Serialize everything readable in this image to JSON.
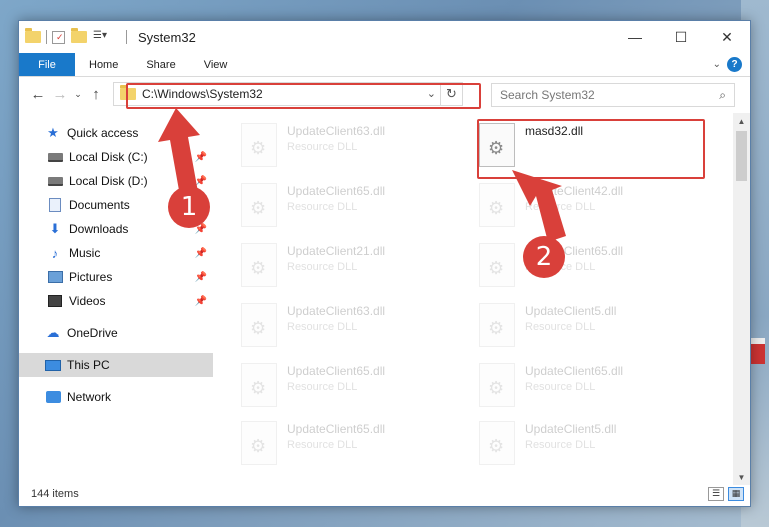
{
  "window": {
    "title": "System32",
    "controls": {
      "minimize": "—",
      "maximize": "☐",
      "close": "✕"
    }
  },
  "ribbon": {
    "tabs": [
      "File",
      "Home",
      "Share",
      "View"
    ],
    "help": "?"
  },
  "address": {
    "path": "C:\\Windows\\System32",
    "search_placeholder": "Search System32"
  },
  "sidebar": {
    "items": [
      {
        "label": "Quick access",
        "icon": "star-icon",
        "pinned": false
      },
      {
        "label": "Local Disk (C:)",
        "icon": "drive-icon",
        "pinned": true
      },
      {
        "label": "Local Disk (D:)",
        "icon": "drive-icon",
        "pinned": true
      },
      {
        "label": "Documents",
        "icon": "document-icon",
        "pinned": true
      },
      {
        "label": "Downloads",
        "icon": "download-icon",
        "pinned": true
      },
      {
        "label": "Music",
        "icon": "music-icon",
        "pinned": true
      },
      {
        "label": "Pictures",
        "icon": "pictures-icon",
        "pinned": true
      },
      {
        "label": "Videos",
        "icon": "videos-icon",
        "pinned": true
      },
      {
        "label": "OneDrive",
        "icon": "cloud-icon",
        "pinned": false
      },
      {
        "label": "This PC",
        "icon": "computer-icon",
        "pinned": false,
        "selected": true
      },
      {
        "label": "Network",
        "icon": "network-icon",
        "pinned": false
      }
    ]
  },
  "files": [
    {
      "name": "UpdateClient63.dll",
      "type": "Resource DLL",
      "faded": true
    },
    {
      "name": "masd32.dll",
      "type": "",
      "faded": false
    },
    {
      "name": "UpdateClient65.dll",
      "type": "Resource DLL",
      "faded": true
    },
    {
      "name": "UpdateClient42.dll",
      "type": "Resource DLL",
      "faded": true
    },
    {
      "name": "UpdateClient21.dll",
      "type": "Resource DLL",
      "faded": true
    },
    {
      "name": "UpdateClient65.dll",
      "type": "Resource DLL",
      "faded": true
    },
    {
      "name": "UpdateClient63.dll",
      "type": "Resource DLL",
      "faded": true
    },
    {
      "name": "UpdateClient5.dll",
      "type": "Resource DLL",
      "faded": true
    },
    {
      "name": "UpdateClient65.dll",
      "type": "Resource DLL",
      "faded": true
    },
    {
      "name": "UpdateClient65.dll",
      "type": "Resource DLL",
      "faded": true
    },
    {
      "name": "UpdateClient65.dll",
      "type": "Resource DLL",
      "faded": true
    },
    {
      "name": "UpdateClient5.dll",
      "type": "Resource DLL",
      "faded": true
    }
  ],
  "status": {
    "item_count": "144 items"
  },
  "annotations": {
    "marker1": "1",
    "marker2": "2",
    "color": "#d9403a"
  }
}
